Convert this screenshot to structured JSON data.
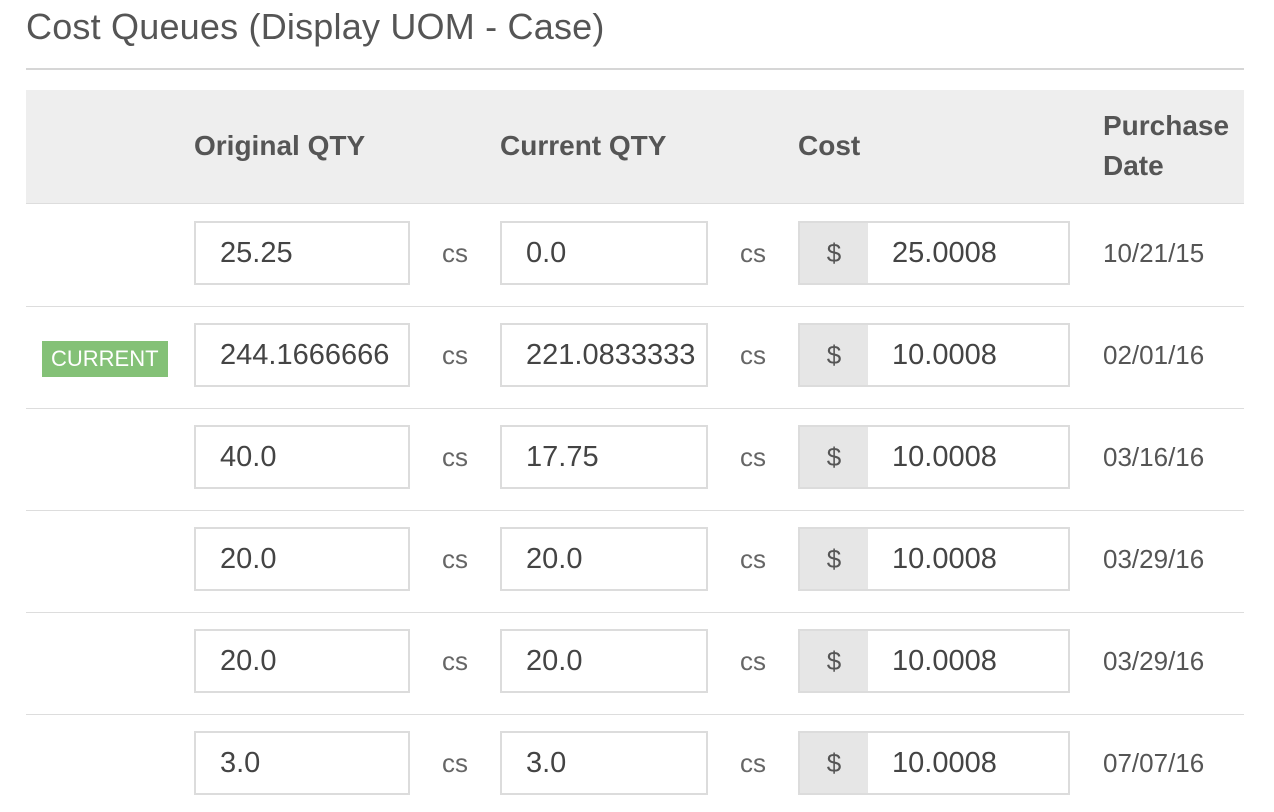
{
  "title": "Cost Queues (Display UOM - Case)",
  "columns": {
    "original_qty": "Original QTY",
    "current_qty": "Current QTY",
    "cost": "Cost",
    "purchase_date_line1": "Purchase",
    "purchase_date_line2": "Date"
  },
  "currency_symbol": "$",
  "uom": "cs",
  "current_badge": "CURRENT",
  "colors": {
    "badge": "#84c177",
    "header_bg": "#eeeeee"
  },
  "rows": [
    {
      "badge": "",
      "original_qty": "25.25",
      "current_qty": "0.0",
      "cost": "25.0008",
      "purchase_date": "10/21/15"
    },
    {
      "badge": "CURRENT",
      "original_qty": "244.1666666",
      "current_qty": "221.0833333",
      "cost": "10.0008",
      "purchase_date": "02/01/16"
    },
    {
      "badge": "",
      "original_qty": "40.0",
      "current_qty": "17.75",
      "cost": "10.0008",
      "purchase_date": "03/16/16"
    },
    {
      "badge": "",
      "original_qty": "20.0",
      "current_qty": "20.0",
      "cost": "10.0008",
      "purchase_date": "03/29/16"
    },
    {
      "badge": "",
      "original_qty": "20.0",
      "current_qty": "20.0",
      "cost": "10.0008",
      "purchase_date": "03/29/16"
    },
    {
      "badge": "",
      "original_qty": "3.0",
      "current_qty": "3.0",
      "cost": "10.0008",
      "purchase_date": "07/07/16"
    }
  ]
}
